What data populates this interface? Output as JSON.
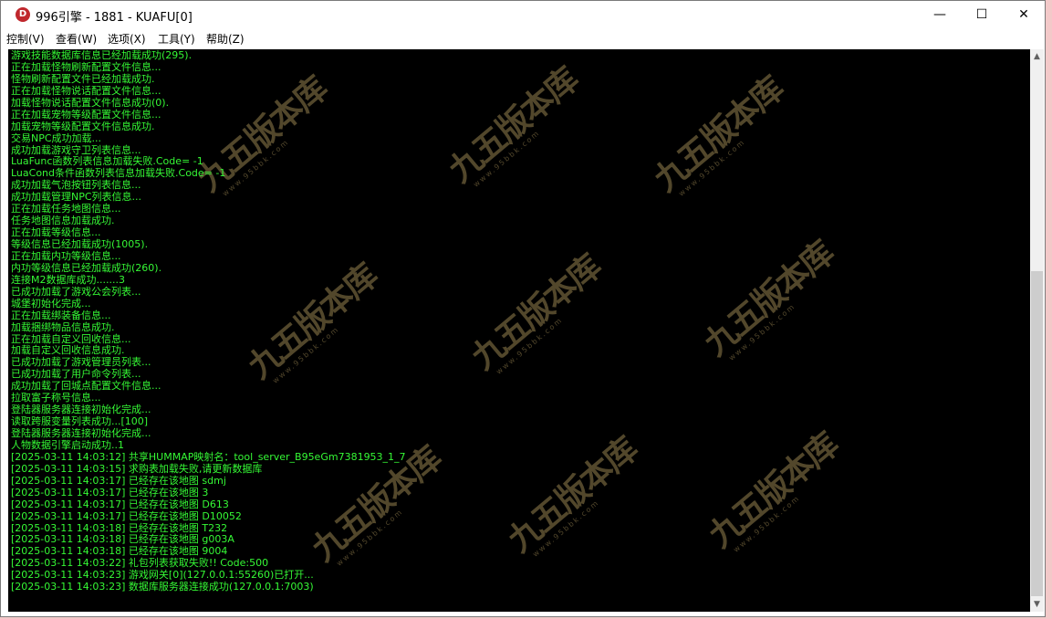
{
  "window": {
    "title": "996引擎 - 1881 - KUAFU[0]",
    "icon_glyph": "D",
    "controls": {
      "minimize": "—",
      "maximize": "☐",
      "close": "✕"
    }
  },
  "menu": {
    "items": [
      {
        "label": "控制(V)"
      },
      {
        "label": "查看(W)"
      },
      {
        "label": "选项(X)"
      },
      {
        "label": "工具(Y)"
      },
      {
        "label": "帮助(Z)"
      }
    ]
  },
  "console": {
    "text_color": "#35f835",
    "background": "#000000",
    "lines": [
      "游戏技能数据库信息已经加载成功(295).",
      "正在加载怪物刷新配置文件信息...",
      "怪物刷新配置文件已经加载成功.",
      "正在加载怪物说话配置文件信息...",
      "加载怪物说话配置文件信息成功(0).",
      "正在加载宠物等级配置文件信息...",
      "加载宠物等级配置文件信息成功.",
      "交易NPC成功加载...",
      "成功加载游戏守卫列表信息...",
      "LuaFunc函数列表信息加载失败.Code= -1",
      "LuaCond条件函数列表信息加载失败.Code= -1",
      "成功加载气泡按钮列表信息...",
      "成功加载管理NPC列表信息...",
      "正在加载任务地图信息...",
      "任务地图信息加载成功.",
      "正在加载等级信息...",
      "等级信息已经加载成功(1005).",
      "正在加载内功等级信息...",
      "内功等级信息已经加载成功(260).",
      "连接M2数据库成功.......3",
      "已成功加载了游戏公会列表...",
      "城堡初始化完成...",
      "正在加载绑装备信息...",
      "加载捆绑物品信息成功.",
      "正在加载自定义回收信息...",
      "加载自定义回收信息成功.",
      "已成功加载了游戏管理员列表...",
      "已成功加载了用户命令列表...",
      "成功加载了回城点配置文件信息...",
      "拉取富子称号信息...",
      "登陆器服务器连接初始化完成...",
      "读取跨服变量列表成功...[100]",
      "登陆器服务器连接初始化完成...",
      "人物数据引擎启动成功..1",
      "[2025-03-11 14:03:12] 共享HUMMAP映射名：tool_server_B95eGm7381953_1_7",
      "[2025-03-11 14:03:15] 求购表加载失败,请更新数据库",
      "[2025-03-11 14:03:17] 已经存在该地图 sdmj",
      "[2025-03-11 14:03:17] 已经存在该地图 3",
      "[2025-03-11 14:03:17] 已经存在该地图 D613",
      "[2025-03-11 14:03:17] 已经存在该地图 D10052",
      "[2025-03-11 14:03:18] 已经存在该地图 T232",
      "[2025-03-11 14:03:18] 已经存在该地图 g003A",
      "[2025-03-11 14:03:18] 已经存在该地图 9004",
      "[2025-03-11 14:03:22] 礼包列表获取失败!! Code:500",
      "[2025-03-11 14:03:23] 游戏网关[0](127.0.0.1:55260)已打开...",
      "[2025-03-11 14:03:23] 数据库服务器连接成功(127.0.0.1:7003)"
    ]
  },
  "watermark": {
    "main": "九五版本库",
    "sub": "www.95bbk.com",
    "color": "#6e5f3a"
  },
  "scrollbar": {
    "up_glyph": "▲",
    "down_glyph": "▼"
  }
}
